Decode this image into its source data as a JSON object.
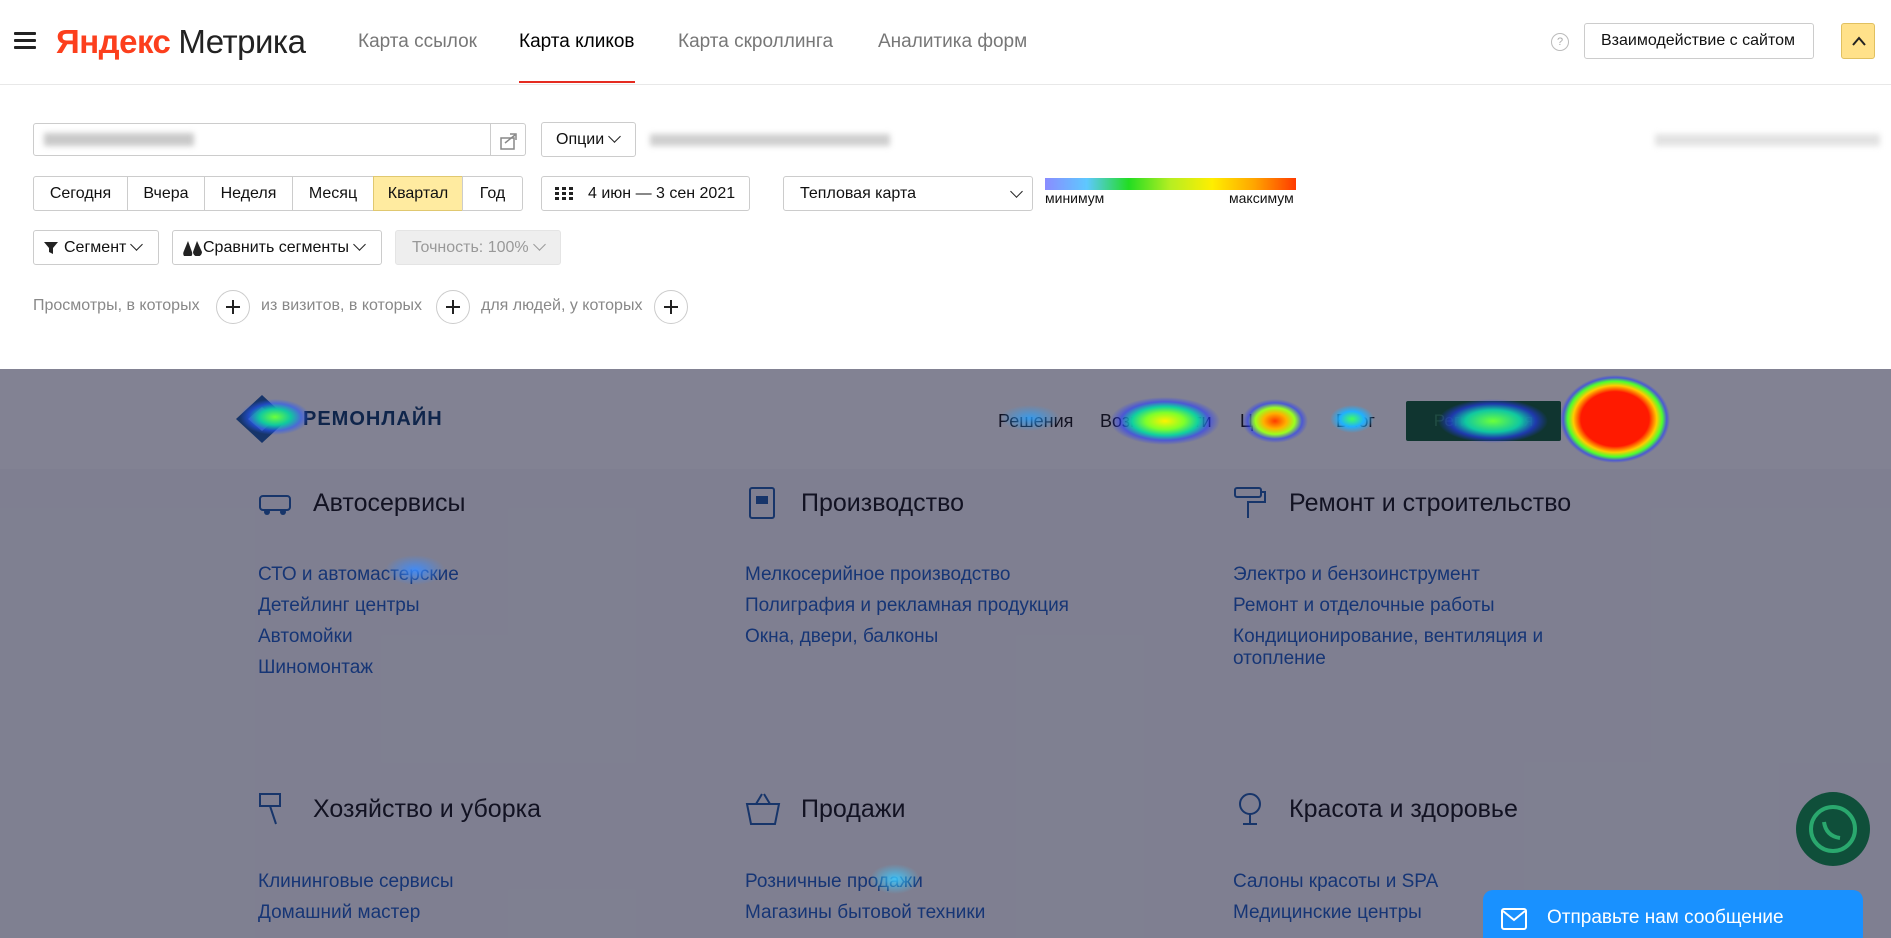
{
  "app": {
    "logo_brand": "Яндекс",
    "logo_product": "Метрика"
  },
  "nav": {
    "tabs": [
      {
        "label": "Карта ссылок",
        "active": false
      },
      {
        "label": "Карта кликов",
        "active": true
      },
      {
        "label": "Карта скроллинга",
        "active": false
      },
      {
        "label": "Аналитика форм",
        "active": false
      }
    ],
    "help_label": "?",
    "interaction_button": "Взаимодействие с сайтом"
  },
  "controls": {
    "options_label": "Опции",
    "period_buttons": [
      {
        "label": "Сегодня",
        "selected": false
      },
      {
        "label": "Вчера",
        "selected": false
      },
      {
        "label": "Неделя",
        "selected": false
      },
      {
        "label": "Месяц",
        "selected": false
      },
      {
        "label": "Квартал",
        "selected": true
      },
      {
        "label": "Год",
        "selected": false
      }
    ],
    "date_range": "4 июн — 3 сен 2021",
    "map_type": "Тепловая карта",
    "gradient_min": "минимум",
    "gradient_max": "максимум",
    "segment_label": "Сегмент",
    "compare_label": "Сравнить сегменты",
    "accuracy_label": "Точность: 100%",
    "filters": [
      "Просмотры, в которых",
      "из визитов, в которых",
      "для людей, у которых"
    ]
  },
  "site": {
    "logo_text": "РЕМОНЛАЙН",
    "nav": [
      "Решения",
      "Возможности",
      "Цены",
      "Блог"
    ],
    "register_label": "Регистрация",
    "categories": [
      {
        "title": "Автосервисы",
        "icon": "car-service-icon",
        "links": [
          "СТО и автомастерские",
          "Детейлинг центры",
          "Автомойки",
          "Шиномонтаж"
        ]
      },
      {
        "title": "Производство",
        "icon": "factory-icon",
        "links": [
          "Мелкосерийное производство",
          "Полиграфия и рекламная продукция",
          "Окна, двери, балконы"
        ]
      },
      {
        "title": "Ремонт и строительство",
        "icon": "paint-roller-icon",
        "links": [
          "Электро и бензоинструмент",
          "Ремонт и отделочные работы",
          "Кондиционирование, вентиляция и",
          "отопление"
        ]
      },
      {
        "title": "Хозяйство и уборка",
        "icon": "cleaning-icon",
        "links": [
          "Клининговые сервисы",
          "Домашний мастер"
        ]
      },
      {
        "title": "Продажи",
        "icon": "shopping-basket-icon",
        "links": [
          "Розничные продажи",
          "Магазины бытовой техники"
        ]
      },
      {
        "title": "Красота и здоровье",
        "icon": "beauty-icon",
        "links": [
          "Салоны красоты и SPA",
          "Медицинские центры"
        ]
      }
    ],
    "chat_label": "Отправьте нам сообщение"
  },
  "colors": {
    "accent_red": "#e52b20",
    "selected_yellow": "#ffeba0",
    "link_blue": "#1a5bbf",
    "chat_blue": "#1991ff"
  }
}
